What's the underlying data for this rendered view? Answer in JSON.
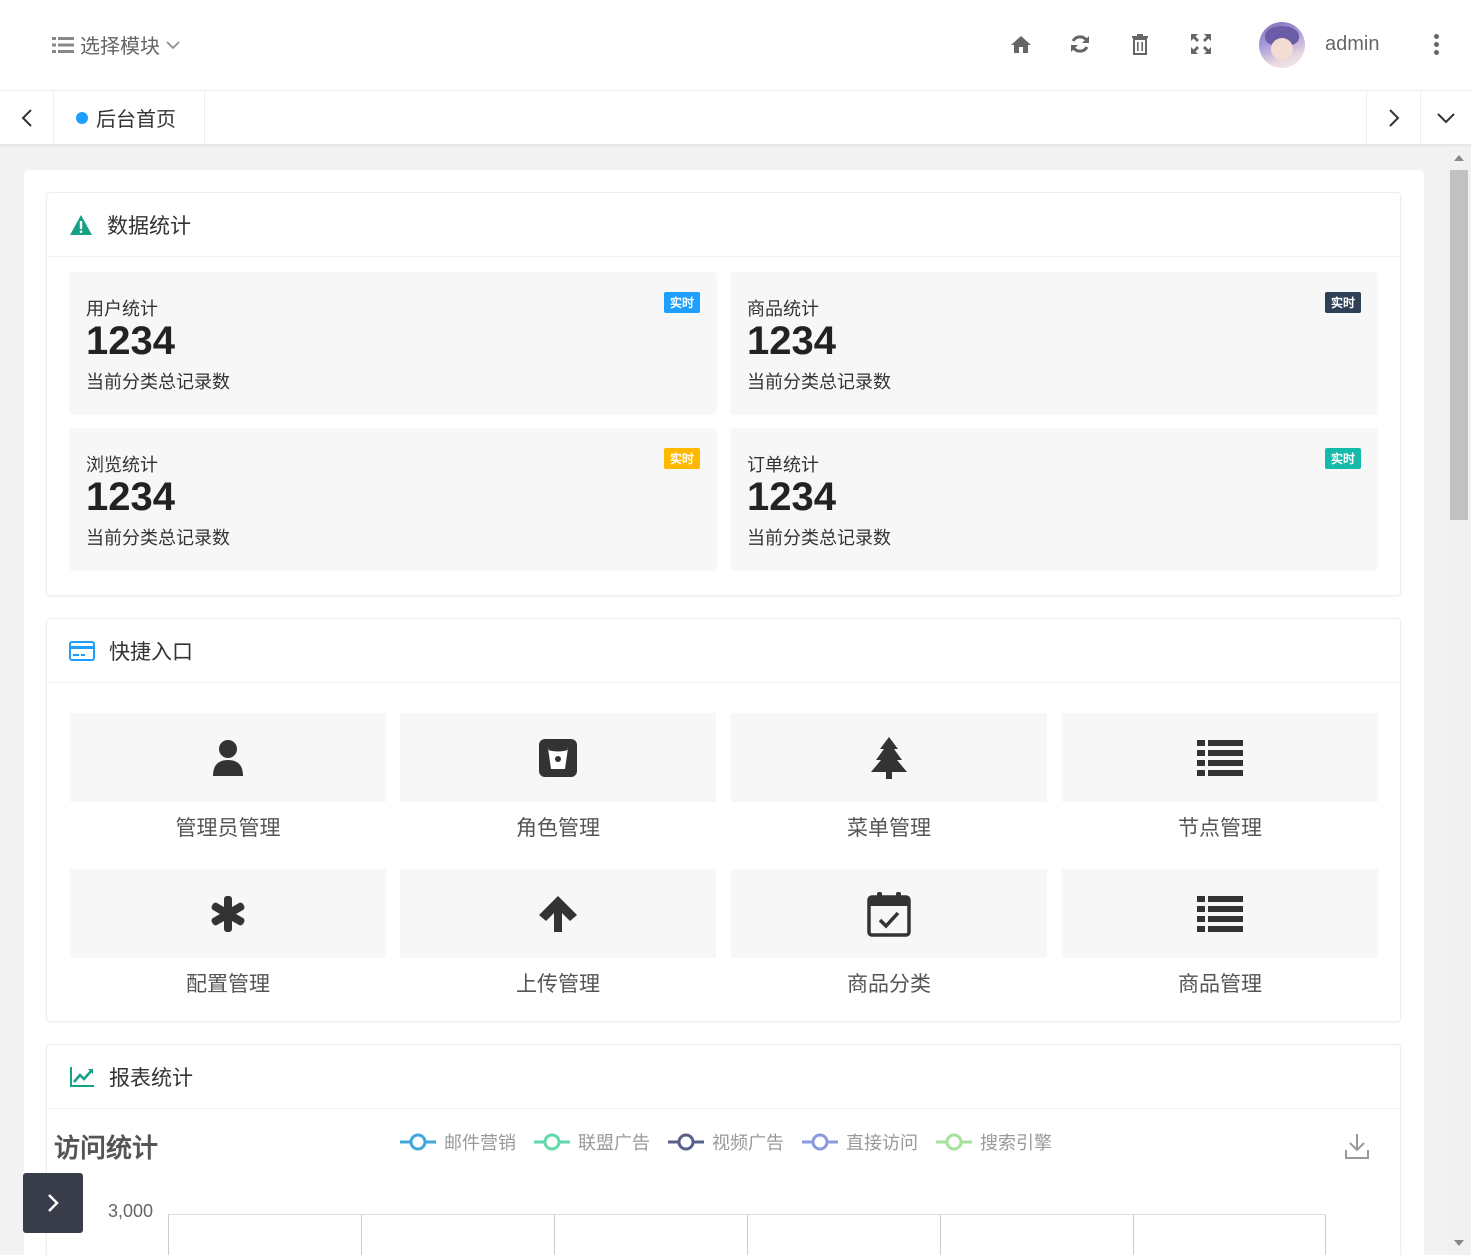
{
  "header": {
    "module_select_label": "选择模块",
    "username": "admin"
  },
  "tabs": {
    "active_tab": "后台首页"
  },
  "stats_section": {
    "title": "数据统计",
    "cards": [
      {
        "title": "用户统计",
        "value": "1234",
        "desc": "当前分类总记录数",
        "badge": "实时",
        "badge_color": "#1e9fff"
      },
      {
        "title": "商品统计",
        "value": "1234",
        "desc": "当前分类总记录数",
        "badge": "实时",
        "badge_color": "#2f4056"
      },
      {
        "title": "浏览统计",
        "value": "1234",
        "desc": "当前分类总记录数",
        "badge": "实时",
        "badge_color": "#ffb800"
      },
      {
        "title": "订单统计",
        "value": "1234",
        "desc": "当前分类总记录数",
        "badge": "实时",
        "badge_color": "#16baaa"
      }
    ]
  },
  "shortcuts_section": {
    "title": "快捷入口",
    "items": [
      {
        "label": "管理员管理",
        "icon": "user-icon"
      },
      {
        "label": "角色管理",
        "icon": "bitbucket-icon"
      },
      {
        "label": "菜单管理",
        "icon": "tree-icon"
      },
      {
        "label": "节点管理",
        "icon": "list-icon"
      },
      {
        "label": "配置管理",
        "icon": "asterisk-icon"
      },
      {
        "label": "上传管理",
        "icon": "arrow-up-icon"
      },
      {
        "label": "商品分类",
        "icon": "calendar-check-icon"
      },
      {
        "label": "商品管理",
        "icon": "list-icon"
      }
    ]
  },
  "report_section": {
    "title": "报表统计",
    "chart_title": "访问统计",
    "legend": [
      {
        "name": "邮件营销",
        "color": "#3fa7dc"
      },
      {
        "name": "联盟广告",
        "color": "#5fd9a8"
      },
      {
        "name": "视频广告",
        "color": "#58608a"
      },
      {
        "name": "直接访问",
        "color": "#8c9adb"
      },
      {
        "name": "搜索引擎",
        "color": "#a6e09d"
      }
    ],
    "y_tick_top": "3,000"
  },
  "chart_data": {
    "type": "line",
    "title": "访问统计",
    "series": [
      {
        "name": "邮件营销",
        "values": []
      },
      {
        "name": "联盟广告",
        "values": []
      },
      {
        "name": "视频广告",
        "values": []
      },
      {
        "name": "直接访问",
        "values": []
      },
      {
        "name": "搜索引擎",
        "values": []
      }
    ],
    "y_ticks_visible": [
      "3,000"
    ],
    "grid": true,
    "legend_position": "top"
  },
  "colors": {
    "accent_blue": "#1e9fff",
    "dark_button": "#393d49"
  }
}
